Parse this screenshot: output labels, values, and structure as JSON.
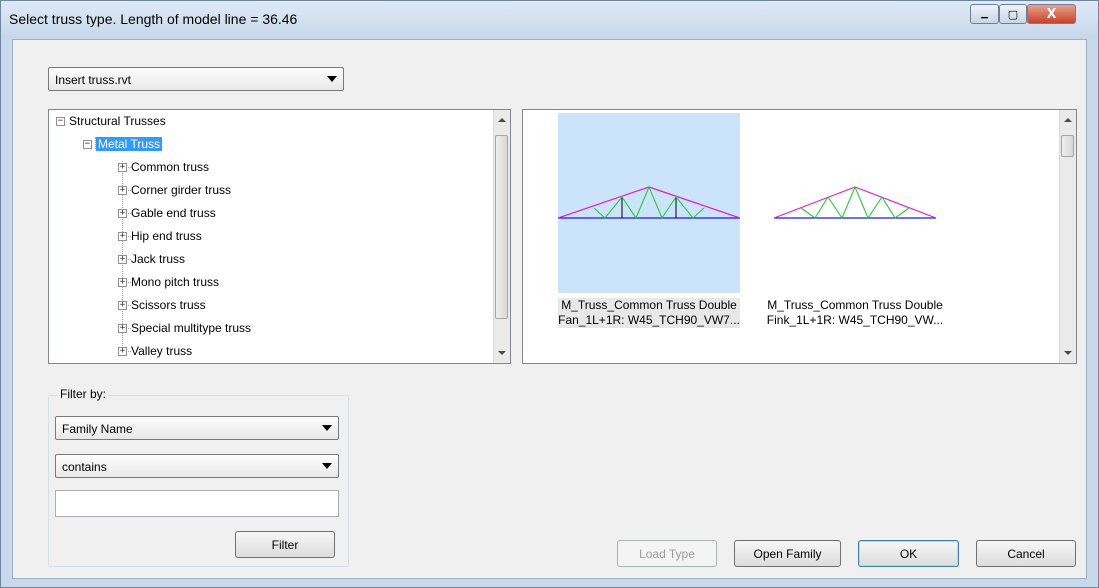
{
  "window": {
    "title": "Select truss type. Length of model line = 36.46",
    "min_glyph": "▁",
    "max_glyph": "▢",
    "close_glyph": "X"
  },
  "file_combo": {
    "value": "Insert truss.rvt"
  },
  "tree": {
    "root": "Structural Trusses",
    "selected": "Metal Truss",
    "children": [
      "Common truss",
      "Corner girder truss",
      "Gable end truss",
      "Hip end truss",
      "Jack truss",
      "Mono pitch truss",
      "Scissors truss",
      "Special multitype truss",
      "Valley truss"
    ],
    "expand_glyph": "+",
    "collapse_glyph": "−"
  },
  "types": [
    {
      "line1": "M_Truss_Common Truss Double",
      "line2": "Fan_1L+1R: W45_TCH90_VW7...",
      "selected": true
    },
    {
      "line1": "M_Truss_Common Truss Double",
      "line2": "Fink_1L+1R: W45_TCH90_VW...",
      "selected": false
    }
  ],
  "filter": {
    "legend": "Filter by:",
    "field": "Family Name",
    "condition": "contains",
    "text": "",
    "button": "Filter"
  },
  "buttons": {
    "load_type": "Load Type",
    "open_family": "Open Family",
    "ok": "OK",
    "cancel": "Cancel"
  },
  "colors": {
    "selection": "#3399ff",
    "thumb_selected_bg": "#cce4fb",
    "truss_chord_top": "#e21bd6",
    "truss_chord_bottom": "#1a1ae0",
    "truss_web": "#22cc33"
  }
}
